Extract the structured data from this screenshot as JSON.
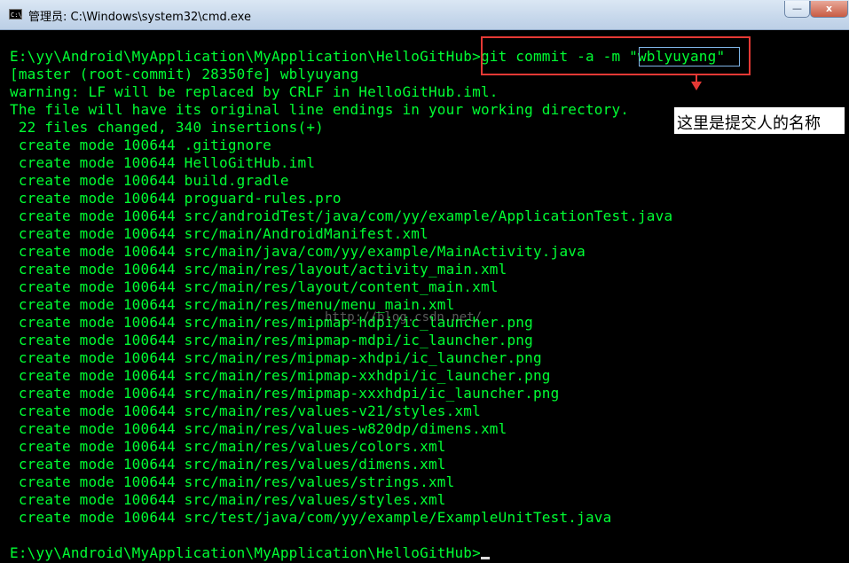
{
  "window": {
    "title": "管理员: C:\\Windows\\system32\\cmd.exe",
    "icon": "cmd-icon",
    "icon_text": "C:\\",
    "minimize_glyph": "—",
    "close_glyph": "x"
  },
  "console": {
    "text_color": "#00ff33",
    "lines": [
      "E:\\yy\\Android\\MyApplication\\MyApplication\\HelloGitHub>git commit -a -m \"wblyuyang\"",
      "[master (root-commit) 28350fe] wblyuyang",
      "warning: LF will be replaced by CRLF in HelloGitHub.iml.",
      "The file will have its original line endings in your working directory.",
      " 22 files changed, 340 insertions(+)",
      " create mode 100644 .gitignore",
      " create mode 100644 HelloGitHub.iml",
      " create mode 100644 build.gradle",
      " create mode 100644 proguard-rules.pro",
      " create mode 100644 src/androidTest/java/com/yy/example/ApplicationTest.java",
      " create mode 100644 src/main/AndroidManifest.xml",
      " create mode 100644 src/main/java/com/yy/example/MainActivity.java",
      " create mode 100644 src/main/res/layout/activity_main.xml",
      " create mode 100644 src/main/res/layout/content_main.xml",
      " create mode 100644 src/main/res/menu/menu_main.xml",
      " create mode 100644 src/main/res/mipmap-hdpi/ic_launcher.png",
      " create mode 100644 src/main/res/mipmap-mdpi/ic_launcher.png",
      " create mode 100644 src/main/res/mipmap-xhdpi/ic_launcher.png",
      " create mode 100644 src/main/res/mipmap-xxhdpi/ic_launcher.png",
      " create mode 100644 src/main/res/mipmap-xxxhdpi/ic_launcher.png",
      " create mode 100644 src/main/res/values-v21/styles.xml",
      " create mode 100644 src/main/res/values-w820dp/dimens.xml",
      " create mode 100644 src/main/res/values/colors.xml",
      " create mode 100644 src/main/res/values/dimens.xml",
      " create mode 100644 src/main/res/values/strings.xml",
      " create mode 100644 src/main/res/values/styles.xml",
      " create mode 100644 src/test/java/com/yy/example/ExampleUnitTest.java",
      "",
      "E:\\yy\\Android\\MyApplication\\MyApplication\\HelloGitHub>"
    ]
  },
  "annotation": {
    "note": "这里是提交人的名称",
    "box_color": "#e53935",
    "highlight_color": "#7fb4e6"
  },
  "watermark": "http://blog.csdn.net/"
}
